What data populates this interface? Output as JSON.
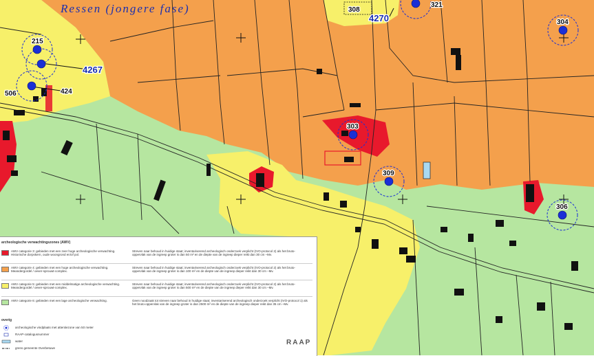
{
  "map": {
    "place_name": "Ressen (jongere fase)",
    "catalogue_numbers": [
      "4267",
      "4270"
    ],
    "sites": [
      "215",
      "506",
      "424",
      "308",
      "321",
      "304",
      "303",
      "309",
      "306"
    ]
  },
  "colors": {
    "zone_very_high": "#e8192c",
    "zone_high": "#f4a04c",
    "zone_medium": "#f7f06a",
    "zone_low": "#b6e6a0",
    "site_dot": "#1a2fd6",
    "label_blue": "#1a2fb0"
  },
  "legend": {
    "title": "archeologische verwachtingszones (AWV)",
    "zones": [
      {
        "label": "AWV categorie 3: gebieden met een zeer hoge archeologische verwachting. Historische dorpskern, oude woongrond en/of pol.",
        "description": "Streven naar behoud in huidige staat; inventariserend archeologisch onderzoek verplicht (IVO-protocol 2) als het bruto-oppervlak van de ingreep groter is dan 50 m² en de diepte van de ingreep dieper reikt dan 30 cm –Mv."
      },
      {
        "label": "AWV categorie 4: gebieden met een hoge archeologische verwachting. Meandergordel / oever-sprouwt-complex.",
        "description": "Streven naar behoud in huidige staat; inventariserend archeologisch onderzoek verplicht (IVO-protocol 2) als het bruto-oppervlak van de ingreep groter is dan 100 m² en de diepte van de ingreep dieper reikt dan 30 cm –Mv."
      },
      {
        "label": "AWV categorie 5: gebieden met een middelmatige archeologische verwachting. Meandergordel / oever-sprouwt-complex.",
        "description": "Streven naar behoud in huidige staat; inventariserend archeologisch onderzoek verplicht (IVO-protocol 2) als het bruto-oppervlak van de ingreep groter is dan 500 m² en de diepte van de ingreep dieper reikt dan 30 cm –Mv."
      },
      {
        "label": "AWV categorie 6: gebieden met een lage archeologische verwachting.",
        "description": "Geen noodzaak tot streven naar behoud in huidige staat; inventariserend archeologisch onderzoek verplicht (IVO-protocol 1) als het bruto-oppervlak van de ingreep groter is dan 2500 m² en de diepte van de ingreep dieper reikt dan 35 cm –Mv."
      }
    ],
    "overig_title": "overig",
    "overig": [
      "archeologische vindplaats met attentiezone van 50 meter",
      "RAAP-catalogusnummer",
      "water",
      "grens gemeente Overbetuwe"
    ],
    "brand": "RAAP"
  }
}
